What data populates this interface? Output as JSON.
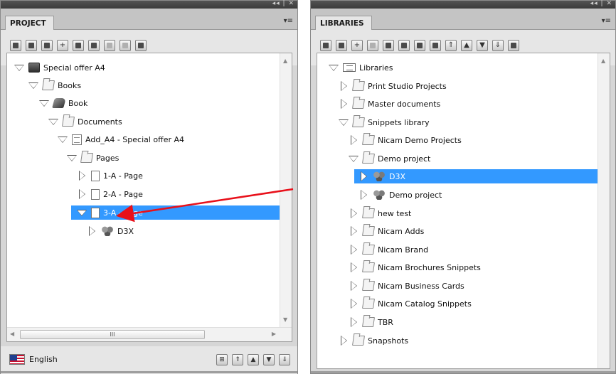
{
  "project": {
    "tab_label": "PROJECT",
    "tree": [
      {
        "label": "Special offer A4",
        "icon": "book-icon",
        "expander": "open",
        "selected": false
      },
      {
        "label": "Books",
        "icon": "folder-icon",
        "expander": "open",
        "selected": false
      },
      {
        "label": "Book",
        "icon": "book2-icon",
        "expander": "open",
        "selected": false
      },
      {
        "label": "Documents",
        "icon": "folder-icon",
        "expander": "open",
        "selected": false
      },
      {
        "label": "Add_A4 - Special offer A4",
        "icon": "document-icon",
        "expander": "open",
        "selected": false
      },
      {
        "label": "Pages",
        "icon": "folder-icon",
        "expander": "open",
        "selected": false
      },
      {
        "label": "1-A - Page",
        "icon": "page-icon",
        "expander": "closed",
        "selected": false
      },
      {
        "label": "2-A - Page",
        "icon": "page-icon",
        "expander": "closed",
        "selected": false
      },
      {
        "label": "3-A - Page",
        "icon": "page-icon",
        "expander": "open",
        "selected": true
      },
      {
        "label": "D3X",
        "icon": "cubes-icon",
        "expander": "closed",
        "selected": false
      }
    ],
    "scroll_thumb_glyph": "III",
    "footer": {
      "language": "English",
      "flag": "us-flag-icon"
    }
  },
  "libraries": {
    "tab_label": "LIBRARIES",
    "tree": [
      {
        "label": "Libraries",
        "icon": "library-icon",
        "expander": "open",
        "selected": false
      },
      {
        "label": "Print Studio Projects",
        "icon": "folder-icon",
        "expander": "closed",
        "selected": false
      },
      {
        "label": "Master documents",
        "icon": "folder-icon",
        "expander": "closed",
        "selected": false
      },
      {
        "label": "Snippets library",
        "icon": "folder-icon",
        "expander": "open",
        "selected": false
      },
      {
        "label": "Nicam Demo Projects",
        "icon": "folder-icon",
        "expander": "closed",
        "selected": false
      },
      {
        "label": "Demo project",
        "icon": "folder-icon",
        "expander": "open",
        "selected": false
      },
      {
        "label": "D3X",
        "icon": "cubes-icon",
        "expander": "closed",
        "selected": true
      },
      {
        "label": "Demo project",
        "icon": "cubes-icon",
        "expander": "closed",
        "selected": false
      },
      {
        "label": "hew test",
        "icon": "folder-icon",
        "expander": "closed",
        "selected": false
      },
      {
        "label": "Nicam Adds",
        "icon": "folder-icon",
        "expander": "closed",
        "selected": false
      },
      {
        "label": "Nicam Brand",
        "icon": "folder-icon",
        "expander": "closed",
        "selected": false
      },
      {
        "label": "Nicam Brochures Snippets",
        "icon": "folder-icon",
        "expander": "closed",
        "selected": false
      },
      {
        "label": "Nicam Business Cards",
        "icon": "folder-icon",
        "expander": "closed",
        "selected": false
      },
      {
        "label": "Nicam Catalog Snippets",
        "icon": "folder-icon",
        "expander": "closed",
        "selected": false
      },
      {
        "label": "TBR",
        "icon": "folder-icon",
        "expander": "closed",
        "selected": false
      },
      {
        "label": "Snapshots",
        "icon": "folder-icon",
        "expander": "closed",
        "selected": false
      }
    ]
  },
  "colors": {
    "selection": "#3399ff",
    "annotation_arrow": "#e8101a",
    "panel_header": "#3a3a3a"
  }
}
